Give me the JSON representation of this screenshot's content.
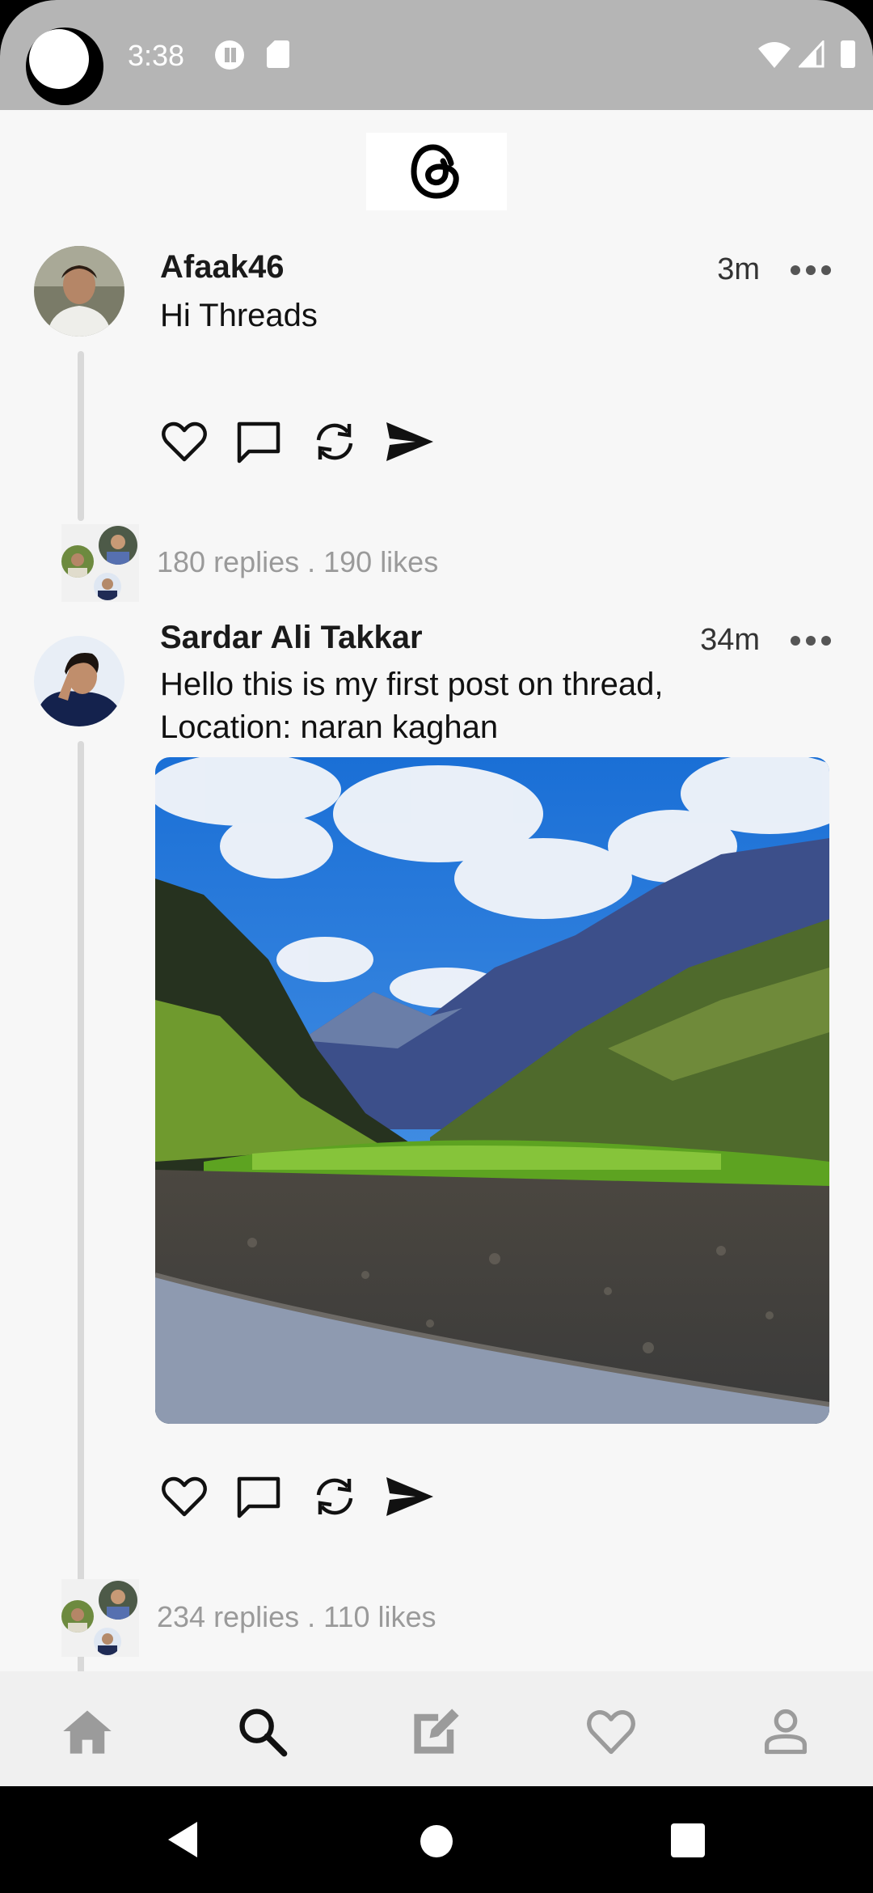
{
  "status_bar": {
    "time": "3:38",
    "icons": [
      "camera-cutout",
      "pocket-icon",
      "sd-card-icon",
      "wifi-icon",
      "signal-icon",
      "battery-icon"
    ]
  },
  "app": {
    "logo_icon": "threads-logo"
  },
  "posts": [
    {
      "username": "Afaak46",
      "time": "3m",
      "text": "Hi Threads",
      "stats": "180 replies . 190 likes",
      "has_image": false
    },
    {
      "username": "Sardar Ali Takkar",
      "time": "34m",
      "text_line1": "Hello this is my first post on thread,",
      "text_line2": "Location: naran kaghan",
      "stats": "234 replies . 110 likes",
      "has_image": true
    }
  ],
  "post_actions": [
    "like-icon",
    "comment-icon",
    "repost-icon",
    "share-icon"
  ],
  "bottom_nav": {
    "items": [
      "home-icon",
      "search-icon",
      "compose-icon",
      "activity-icon",
      "profile-icon"
    ],
    "active": "search-icon"
  },
  "system_nav": [
    "back-icon",
    "home-button-icon",
    "recents-icon"
  ],
  "colors": {
    "status_bar": "#b5b5b5",
    "background": "#f7f7f7",
    "bottom_nav": "#f0f0f0",
    "muted_text": "#9a9a9a",
    "sky": "#2f7fe0"
  }
}
